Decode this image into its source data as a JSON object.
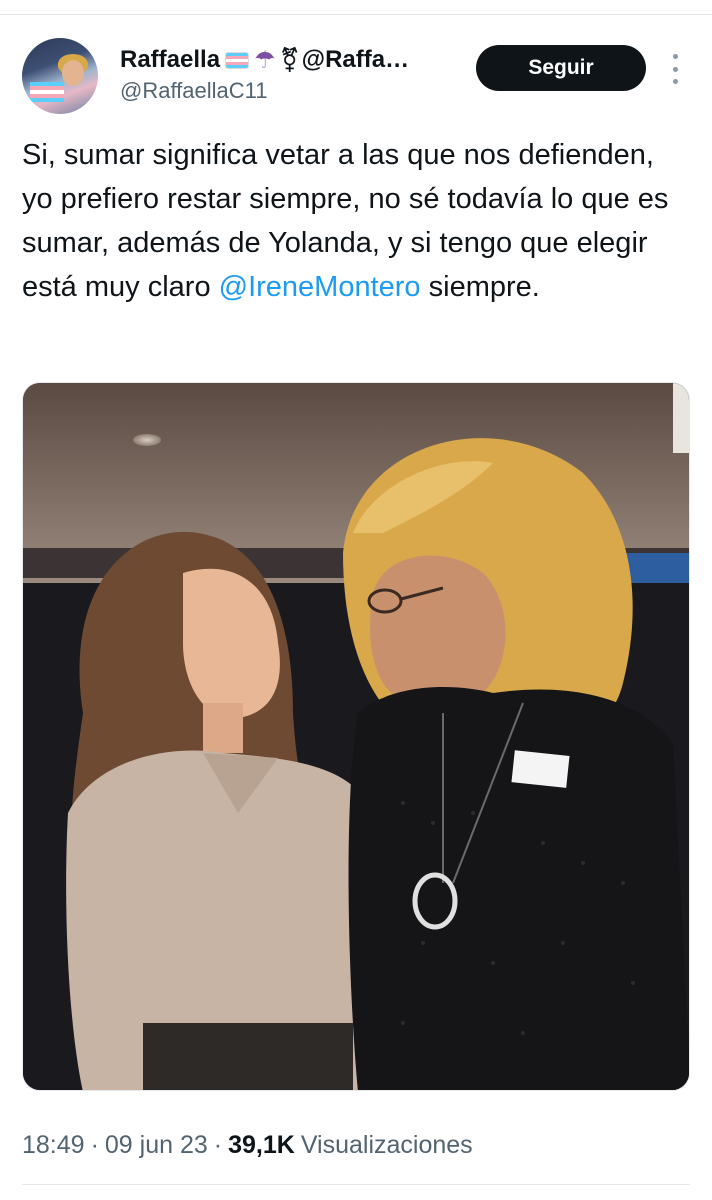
{
  "tweet": {
    "author": {
      "display_name": "Raffaella",
      "name_emojis": [
        "transgender-flag",
        "umbrella",
        "transgender-symbol"
      ],
      "name_suffix": "@Raffa…",
      "umbrella_glyph": "☂",
      "symbol_glyph": "⚧",
      "handle": "@RaffaellaC11",
      "avatar": "profile-photo"
    },
    "follow_label": "Seguir",
    "more_icon": "more-vertical-icon",
    "text_before_mention": "Si, sumar significa vetar a las que nos defienden, yo prefiero restar siempre, no sé  todavía lo que es sumar, además de Yolanda, y si tengo que elegir está muy claro ",
    "mention": "@IreneMontero",
    "text_after_mention": " siempre.",
    "media": "photo of two women smiling at each other",
    "time": "18:49",
    "separator": "·",
    "date": "09 jun 23",
    "views_count": "39,1K",
    "views_label": "Visualizaciones"
  },
  "colors": {
    "text": "#0f1419",
    "secondary": "#536471",
    "mention": "#1d9bf0",
    "button_bg": "#0f1419",
    "button_text": "#ffffff",
    "divider": "#e6e9ec"
  }
}
